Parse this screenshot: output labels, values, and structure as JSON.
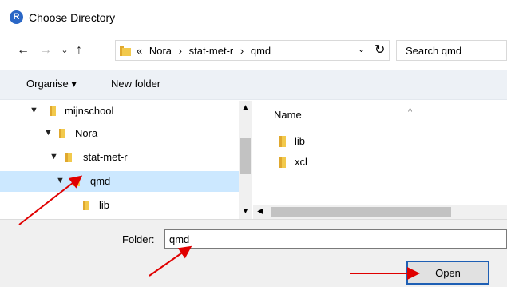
{
  "window": {
    "title": "Choose Directory",
    "app_icon_letter": "R"
  },
  "nav": {
    "back_icon": "back-arrow-icon",
    "forward_icon": "forward-arrow-icon",
    "recent_icon": "chevron-down-icon",
    "up_icon": "up-arrow-icon",
    "address": {
      "overflow": "«",
      "crumbs": [
        "Nora",
        "stat-met-r",
        "qmd"
      ],
      "separator": "›"
    },
    "refresh_icon": "refresh-icon"
  },
  "search": {
    "placeholder": "Search qmd"
  },
  "toolbar": {
    "organise_label": "Organise ▾",
    "new_folder_label": "New folder"
  },
  "tree": {
    "items": [
      {
        "label": "mijnschool",
        "expanded": true,
        "selected": false
      },
      {
        "label": "Nora",
        "expanded": true,
        "selected": false
      },
      {
        "label": "stat-met-r",
        "expanded": true,
        "selected": false
      },
      {
        "label": "qmd",
        "expanded": true,
        "selected": true
      },
      {
        "label": "lib",
        "expanded": false,
        "selected": false
      }
    ]
  },
  "files": {
    "column_name": "Name",
    "items": [
      {
        "name": "lib"
      },
      {
        "name": "xcl"
      }
    ]
  },
  "footer": {
    "folder_label": "Folder:",
    "folder_value": "qmd",
    "open_label": "Open"
  },
  "colors": {
    "folder_yellow": "#f2c94c",
    "selection": "#cce8ff",
    "open_button_border": "#1e5fb4",
    "annotation_arrow": "#e00000"
  }
}
